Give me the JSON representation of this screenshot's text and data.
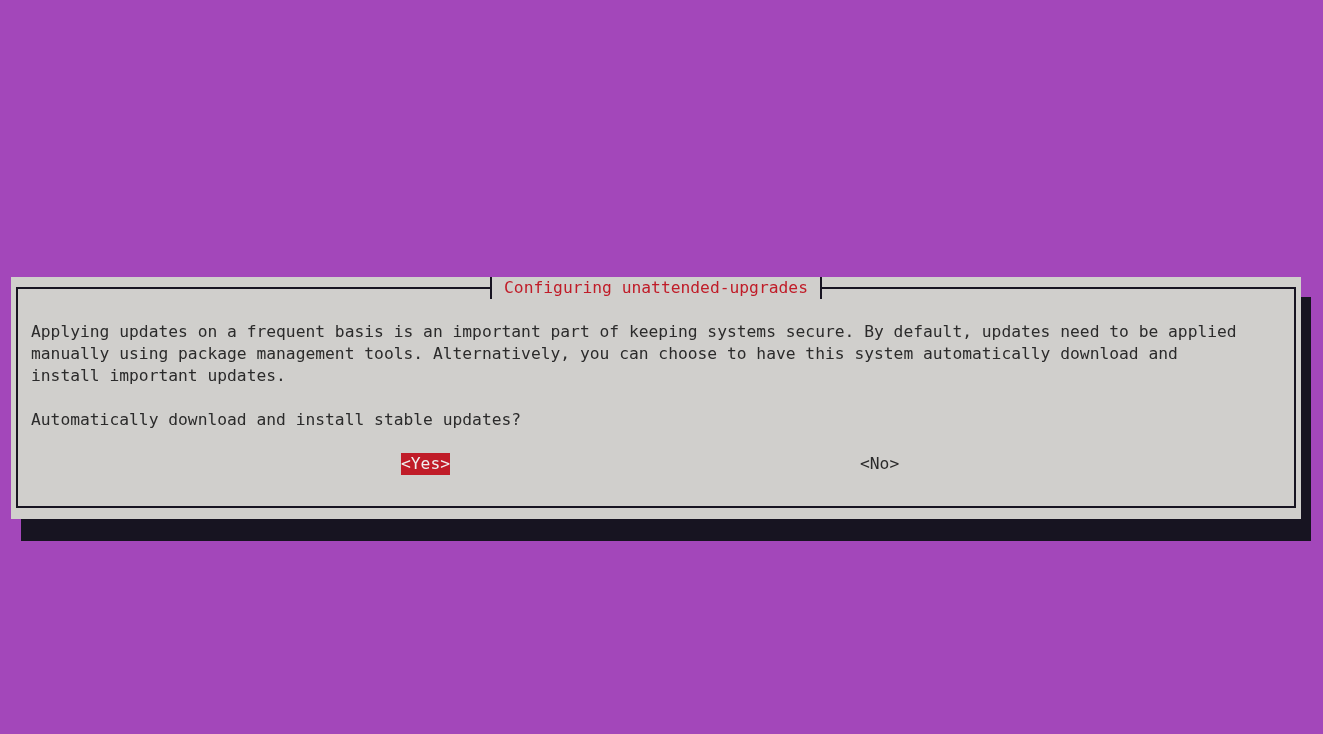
{
  "dialog": {
    "title": "Configuring unattended-upgrades",
    "message_lines": [
      "Applying updates on a frequent basis is an important part of keeping systems secure. By default, updates need to be applied",
      "manually using package management tools. Alternatively, you can choose to have this system automatically download and",
      "install important updates."
    ],
    "question": "Automatically download and install stable updates?",
    "buttons": [
      {
        "label": "<Yes>",
        "selected": true
      },
      {
        "label": "<No>",
        "selected": false
      }
    ]
  }
}
